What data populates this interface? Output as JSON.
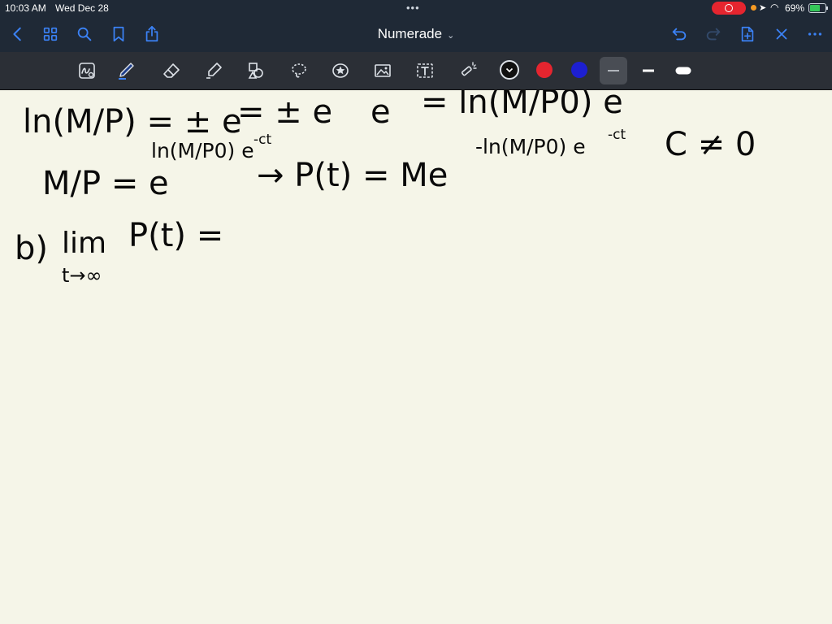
{
  "status_bar": {
    "time": "10:03 AM",
    "date": "Wed Dec 28",
    "battery": "69%",
    "battery_level": 0.69
  },
  "nav_bar": {
    "title": "Numerade",
    "icons": [
      "back-icon",
      "grid-icon",
      "search-icon",
      "bookmark-icon",
      "share-icon",
      "undo-icon",
      "redo-icon",
      "add-page-icon",
      "close-icon",
      "more-icon"
    ]
  },
  "toolbar": {
    "tools": [
      "handwriting-icon",
      "pen-icon",
      "eraser-icon",
      "highlighter-icon",
      "shapes-icon",
      "lasso-icon",
      "sticker-icon",
      "image-icon",
      "text-icon",
      "laser-pointer-icon"
    ],
    "colors": [
      "#111111",
      "#e5252f",
      "#1d1fd1"
    ],
    "accent": "#3b82f6"
  },
  "notes": {
    "line1_left": "ln(M/P) = ± e",
    "line1_mid": "= ± e",
    "line1_e": "e",
    "line1_right": "= ln(M/P0) e",
    "line2_left": "M/P = e",
    "line2_exp": "ln(M/P0) e",
    "line2_exp_sup": "-ct",
    "line2_mid": "→ P(t) = Me",
    "line2_exp2": "-ln(M/P0) e",
    "line2_exp2_sup": "-ct",
    "line2_cond": "C ≠ 0",
    "line3_label": "b)",
    "line3_lim": "lim",
    "line3_sub": "t→∞",
    "line3_expr": "P(t) ="
  }
}
